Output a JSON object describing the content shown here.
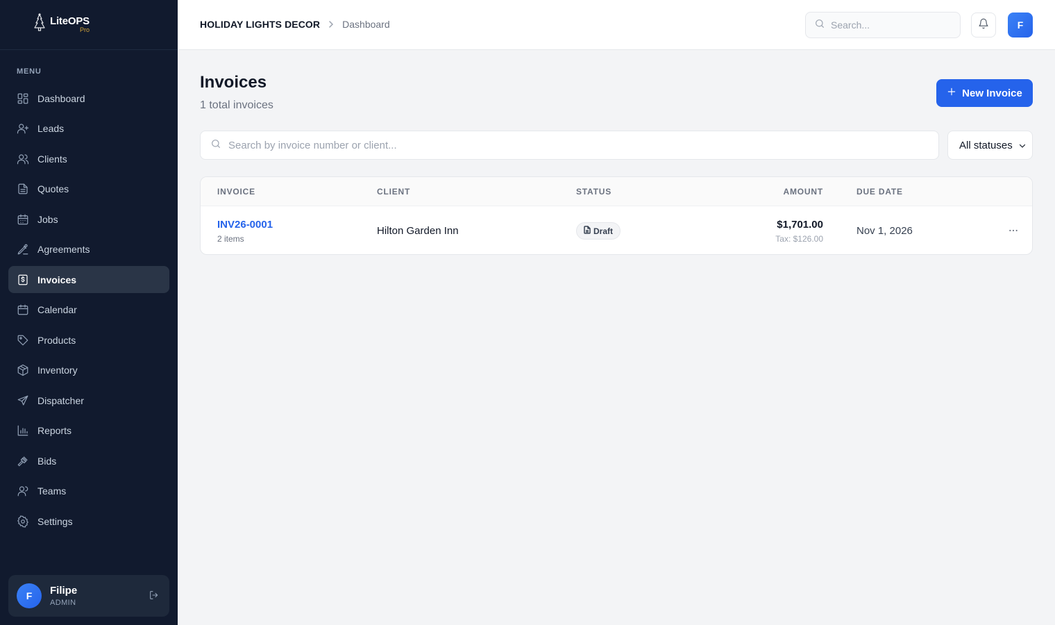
{
  "brand": {
    "name": "LiteOPS",
    "tier": "Pro"
  },
  "sidebar": {
    "menu_label": "MENU",
    "items": [
      {
        "label": "Dashboard",
        "icon": "dashboard-icon"
      },
      {
        "label": "Leads",
        "icon": "user-plus-icon"
      },
      {
        "label": "Clients",
        "icon": "users-icon"
      },
      {
        "label": "Quotes",
        "icon": "file-text-icon"
      },
      {
        "label": "Jobs",
        "icon": "calendar-days-icon"
      },
      {
        "label": "Agreements",
        "icon": "signature-icon"
      },
      {
        "label": "Invoices",
        "icon": "invoice-dollar-icon",
        "active": true
      },
      {
        "label": "Calendar",
        "icon": "calendar-icon"
      },
      {
        "label": "Products",
        "icon": "tag-icon"
      },
      {
        "label": "Inventory",
        "icon": "package-icon"
      },
      {
        "label": "Dispatcher",
        "icon": "send-icon"
      },
      {
        "label": "Reports",
        "icon": "bar-chart-icon"
      },
      {
        "label": "Bids",
        "icon": "gavel-icon"
      },
      {
        "label": "Teams",
        "icon": "team-icon"
      },
      {
        "label": "Settings",
        "icon": "gear-icon"
      }
    ],
    "user": {
      "initial": "F",
      "name": "Filipe",
      "role": "ADMIN"
    }
  },
  "header": {
    "company": "HOLIDAY LIGHTS DECOR",
    "breadcrumb_current": "Dashboard",
    "search_placeholder": "Search...",
    "avatar_initial": "F"
  },
  "main": {
    "title": "Invoices",
    "subtitle": "1 total invoices",
    "new_button_label": "New Invoice",
    "search_placeholder": "Search by invoice number or client...",
    "status_filter": "All statuses",
    "table": {
      "headers": {
        "invoice": "INVOICE",
        "client": "CLIENT",
        "status": "STATUS",
        "amount": "AMOUNT",
        "due_date": "DUE DATE"
      },
      "rows": [
        {
          "invoice_number": "INV26-0001",
          "items": "2 items",
          "client": "Hilton Garden Inn",
          "status": "Draft",
          "amount": "$1,701.00",
          "tax": "Tax: $126.00",
          "due_date": "Nov 1, 2026"
        }
      ]
    }
  },
  "colors": {
    "sidebar_bg": "#111a2e",
    "accent": "#2563eb",
    "brand_gold": "#d4a53a"
  }
}
